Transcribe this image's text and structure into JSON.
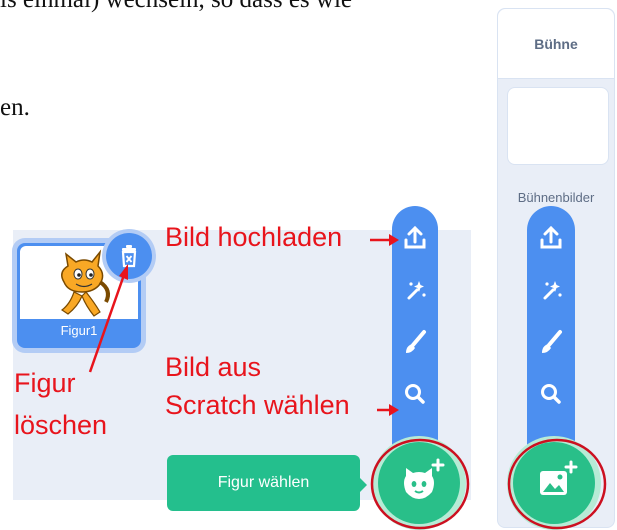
{
  "document": {
    "line1": "is einmal) wechseln, so dass es wie",
    "line2": "en."
  },
  "sprite_pane": {
    "sprite_name": "Figur1",
    "tooltip": "Figur wählen",
    "menu_icons": [
      "upload-icon",
      "surprise-icon",
      "paint-icon",
      "search-icon"
    ],
    "main_button_icon": "choose-sprite-cat-icon",
    "delete_icon": "trash-icon"
  },
  "stage_pane": {
    "title": "Bühne",
    "backdrops_label": "Bühnenbilder",
    "menu_icons": [
      "upload-icon",
      "surprise-icon",
      "paint-icon",
      "search-icon"
    ],
    "main_button_icon": "choose-backdrop-image-icon"
  },
  "annotations": {
    "upload": "Bild hochladen",
    "scratch_line1": "Bild aus",
    "scratch_line2": "Scratch wählen",
    "delete_line1": "Figur",
    "delete_line2": "löschen"
  },
  "colors": {
    "accent_blue": "#4c8ff0",
    "accent_green": "#29bf89",
    "annotation_red": "#e8141c",
    "pane_background": "#e9eef7"
  }
}
